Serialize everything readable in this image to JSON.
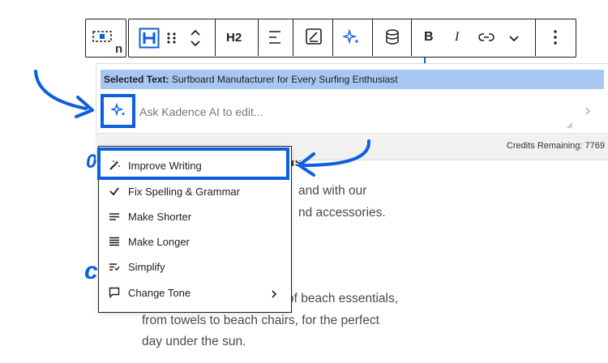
{
  "toolbar": {
    "heading_level": "H2",
    "bold": "B",
    "italic": "I"
  },
  "ai_panel": {
    "selected_label": "Selected Text:",
    "selected_text": "Surfboard Manufacturer for Every Surfing Enthusiast",
    "input_placeholder": "Ask Kadence AI to edit...",
    "credits": "Credits Remaining: 7769"
  },
  "menu": {
    "items": [
      {
        "label": "Improve Writing",
        "icon": "magic-wand-icon"
      },
      {
        "label": "Fix Spelling & Grammar",
        "icon": "check-icon"
      },
      {
        "label": "Make Shorter",
        "icon": "lines-short-icon"
      },
      {
        "label": "Make Longer",
        "icon": "lines-long-icon"
      },
      {
        "label": "Simplify",
        "icon": "simplify-icon"
      },
      {
        "label": "Change Tone",
        "icon": "speech-bubble-icon"
      }
    ]
  },
  "page": {
    "partial_heading_1": "0",
    "partial_heading_2": "c",
    "partial_heading_3": "ls",
    "line_1": "and with our",
    "line_2": "nd accessories.",
    "line_3": "of beach essentials,",
    "line_4": "from towels to beach chairs, for the perfect",
    "line_5": "day under the sun."
  },
  "colors": {
    "accent": "#0b5fe0",
    "selection": "#a7c7f2"
  }
}
